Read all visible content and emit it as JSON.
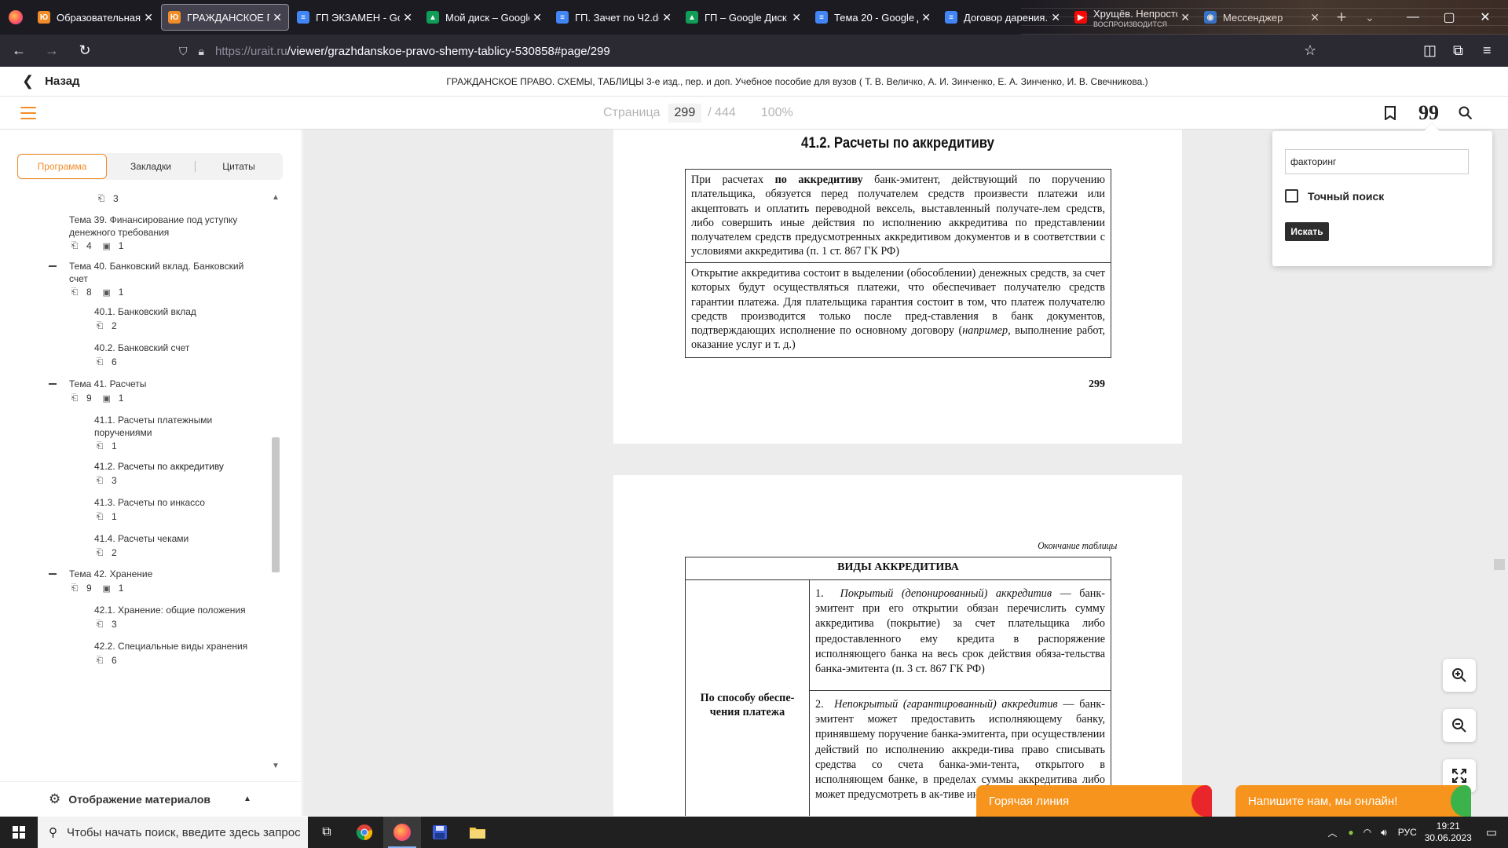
{
  "browser": {
    "tabs": [
      {
        "title": "Образовательная п",
        "favicon": "urait",
        "color": "#f28c28",
        "active": false
      },
      {
        "title": "ГРАЖДАНСКОЕ ПР",
        "favicon": "urait",
        "color": "#f28c28",
        "active": true
      },
      {
        "title": "ГП ЭКЗАМЕН - Goo",
        "favicon": "docs",
        "color": "#4285f4",
        "active": false
      },
      {
        "title": "Мой диск – Google",
        "favicon": "drive",
        "color": "#0f9d58",
        "active": false
      },
      {
        "title": "ГП. Зачет по Ч2.do",
        "favicon": "docs",
        "color": "#4285f4",
        "active": false
      },
      {
        "title": "ГП – Google Диск",
        "favicon": "drive",
        "color": "#0f9d58",
        "active": false
      },
      {
        "title": "Тема 20 - Google Д",
        "favicon": "docs",
        "color": "#4285f4",
        "active": false
      },
      {
        "title": "Договор дарения.d",
        "favicon": "docs",
        "color": "#4285f4",
        "active": false
      },
      {
        "title": "Хрущёв. Непросто",
        "subtitle": "ВОСПРОИЗВОДИТСЯ",
        "favicon": "youtube",
        "color": "#ff0000",
        "active": false
      },
      {
        "title": "Мессенджер",
        "favicon": "messenger",
        "color": "#1a73e8",
        "active": false
      }
    ],
    "new_tab_icon": "plus-icon",
    "url_host": "https://urait.ru",
    "url_path": "/viewer/grazhdanskoe-pravo-shemy-tablicy-530858#page/299"
  },
  "reader": {
    "back_label": "Назад",
    "book_title": "ГРАЖДАНСКОЕ ПРАВО. СХЕМЫ, ТАБЛИЦЫ 3-е изд., пер. и доп. Учебное пособие для вузов ( Т. В. Величко, А. И. Зинченко, Е. А. Зинченко, И. В. Свечникова.)",
    "page_label": "Страница",
    "page_current": "299",
    "page_total": "/ 444",
    "zoom": "100%",
    "accent_color": "#f28c28"
  },
  "sidebar": {
    "tabs": [
      "Программа",
      "Закладки",
      "Цитаты"
    ],
    "active_tab": "Программа",
    "toc": [
      {
        "kind": "meta",
        "count_a": "3",
        "count_b": null
      },
      {
        "kind": "topic",
        "label": "Тема 39. Финансирование под уступку денежного требования",
        "count_a": "4",
        "count_b": "1",
        "expanded": false
      },
      {
        "kind": "topic",
        "label": "Тема 40. Банковский вклад. Банковский счет",
        "count_a": "8",
        "count_b": "1",
        "expanded": true
      },
      {
        "kind": "sub",
        "label": "40.1. Банковский вклад",
        "count_a": "2"
      },
      {
        "kind": "sub",
        "label": "40.2. Банковский счет",
        "count_a": "6"
      },
      {
        "kind": "topic",
        "label": "Тема 41. Расчеты",
        "count_a": "9",
        "count_b": "1",
        "expanded": true
      },
      {
        "kind": "sub",
        "label": "41.1. Расчеты платежными поручениями",
        "count_a": "1"
      },
      {
        "kind": "sub",
        "label": "41.2. Расчеты по аккредитиву",
        "count_a": "3",
        "current": true
      },
      {
        "kind": "sub",
        "label": "41.3. Расчеты по инкассо",
        "count_a": "1"
      },
      {
        "kind": "sub",
        "label": "41.4. Расчеты чеками",
        "count_a": "2"
      },
      {
        "kind": "topic",
        "label": "Тема 42. Хранение",
        "count_a": "9",
        "count_b": "1",
        "expanded": true
      },
      {
        "kind": "sub",
        "label": "42.1. Хранение: общие положения",
        "count_a": "3"
      },
      {
        "kind": "sub",
        "label": "42.2. Специальные виды хранения",
        "count_a": "6"
      }
    ],
    "footer_label": "Отображение материалов"
  },
  "page299": {
    "section_title": "41.2. Расчеты по аккредитиву",
    "box1_pre": "При расчетах ",
    "box1_bold": "по аккредитиву",
    "box1_post": " банк-эмитент, действующий по поручению плательщика, обязуется перед получателем средств произвести платежи или акцептовать и оплатить переводной вексель, выставленный получате-лем средств, либо совершить иные действия по исполнению аккредитива по представлении получателем средств предусмотренных аккредитивом документов и в соответствии с условиями аккредитива (п. 1 ст. 867 ГК РФ)",
    "box2_pre": "Открытие аккредитива состоит в выделении (обособлении) денежных средств, за счет которых будут осуществляться платежи, что обеспечивает получателю средств гарантии платежа. Для плательщика гарантия состоит в том, что платеж получателю средств производится только после пред-ставления в банк документов, подтверждающих исполнение по основному договору (",
    "box2_italic": "например",
    "box2_post": ", выполнение работ, оказание услуг и т. д.)",
    "page_number": "299"
  },
  "page300": {
    "end_note": "Окончание таблицы",
    "table_title": "ВИДЫ АККРЕДИТИВА",
    "row_label": "По способу обеспе-чения платежа",
    "item1_num": "1.",
    "item1_term": "Покрытый (депонированный) аккредитив",
    "item1_text": " — банк-эмитент при его открытии обязан перечислить сумму аккредитива (покрытие) за счет плательщика либо предоставленного ему кредита в распоряжение исполняющего банка на весь срок действия обяза-тельства банка-эмитента (п. 3 ст. 867 ГК РФ)",
    "item2_num": "2.",
    "item2_term": "Непокрытый (гарантированный) аккредитив",
    "item2_text": " — банк-эмитент может предоставить исполняющему банку, принявшему поручение банка-эмитента, при осуществлении действий по исполнению аккреди-тива право списывать средства со счета банка-эми-тента, открытого в исполняющем банке, в пределах суммы аккредитива либо может предусмотреть в ак-тиве иной способ возмещения"
  },
  "search": {
    "query": "факторинг",
    "exact_label": "Точный поиск",
    "exact_checked": false,
    "button_label": "Искать"
  },
  "chat": {
    "hotline_label": "Горячая линия",
    "online_label": "Напишите нам, мы онлайн!",
    "color": "#f7941d"
  },
  "taskbar": {
    "search_placeholder": "Чтобы начать поиск, введите здесь запрос",
    "lang": "РУС",
    "time": "19:21",
    "date": "30.06.2023"
  }
}
